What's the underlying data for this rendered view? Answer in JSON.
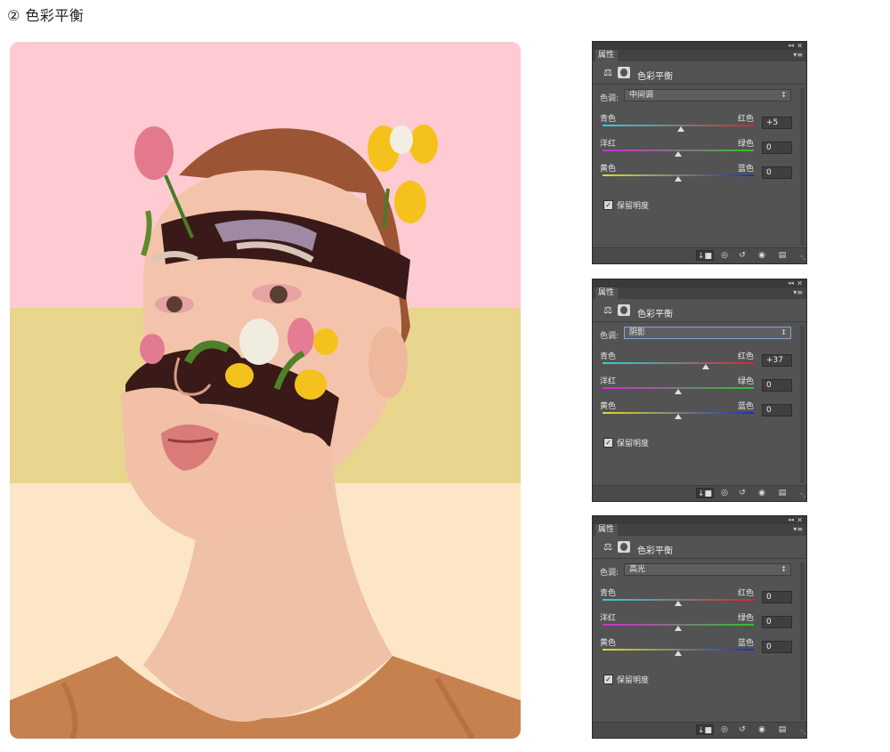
{
  "heading": "② 色彩平衡",
  "artwork": {
    "band_colors": [
      "#fecbd3",
      "#e8d68e",
      "#fde6c6"
    ]
  },
  "panels": [
    {
      "tab": "属性",
      "title": "色彩平衡",
      "tone_label": "色调:",
      "tone_value": "中间调",
      "tone_active": false,
      "sliders": [
        {
          "left": "青色",
          "right": "红色",
          "value": "+5",
          "fraction": 0.52,
          "gradient": [
            "#2fd0d6",
            "#d8262b"
          ]
        },
        {
          "left": "洋红",
          "right": "绿色",
          "value": "0",
          "fraction": 0.5,
          "gradient": [
            "#d12bd4",
            "#2fc12f"
          ]
        },
        {
          "left": "黄色",
          "right": "蓝色",
          "value": "0",
          "fraction": 0.5,
          "gradient": [
            "#e0d82a",
            "#1b2fbf"
          ]
        }
      ],
      "preserve_label": "保留明度",
      "preserve_checked": true
    },
    {
      "tab": "属性",
      "title": "色彩平衡",
      "tone_label": "色调:",
      "tone_value": "阴影",
      "tone_active": true,
      "sliders": [
        {
          "left": "青色",
          "right": "红色",
          "value": "+37",
          "fraction": 0.685,
          "gradient": [
            "#2fd0d6",
            "#d8262b"
          ]
        },
        {
          "left": "洋红",
          "right": "绿色",
          "value": "0",
          "fraction": 0.5,
          "gradient": [
            "#d12bd4",
            "#2fc12f"
          ]
        },
        {
          "left": "黄色",
          "right": "蓝色",
          "value": "0",
          "fraction": 0.5,
          "gradient": [
            "#e0d82a",
            "#1b2fbf"
          ]
        }
      ],
      "preserve_label": "保留明度",
      "preserve_checked": true
    },
    {
      "tab": "属性",
      "title": "色彩平衡",
      "tone_label": "色调:",
      "tone_value": "高光",
      "tone_active": false,
      "sliders": [
        {
          "left": "青色",
          "right": "红色",
          "value": "0",
          "fraction": 0.5,
          "gradient": [
            "#2fd0d6",
            "#d8262b"
          ]
        },
        {
          "left": "洋红",
          "right": "绿色",
          "value": "0",
          "fraction": 0.5,
          "gradient": [
            "#d12bd4",
            "#2fc12f"
          ]
        },
        {
          "left": "黄色",
          "right": "蓝色",
          "value": "0",
          "fraction": 0.5,
          "gradient": [
            "#e0d82a",
            "#1b2fbf"
          ]
        }
      ],
      "preserve_label": "保留明度",
      "preserve_checked": true
    }
  ],
  "footer_icons": [
    "clip-to-layer-icon",
    "view-previous-state-icon",
    "reset-icon",
    "visibility-eye-icon",
    "trash-icon"
  ]
}
